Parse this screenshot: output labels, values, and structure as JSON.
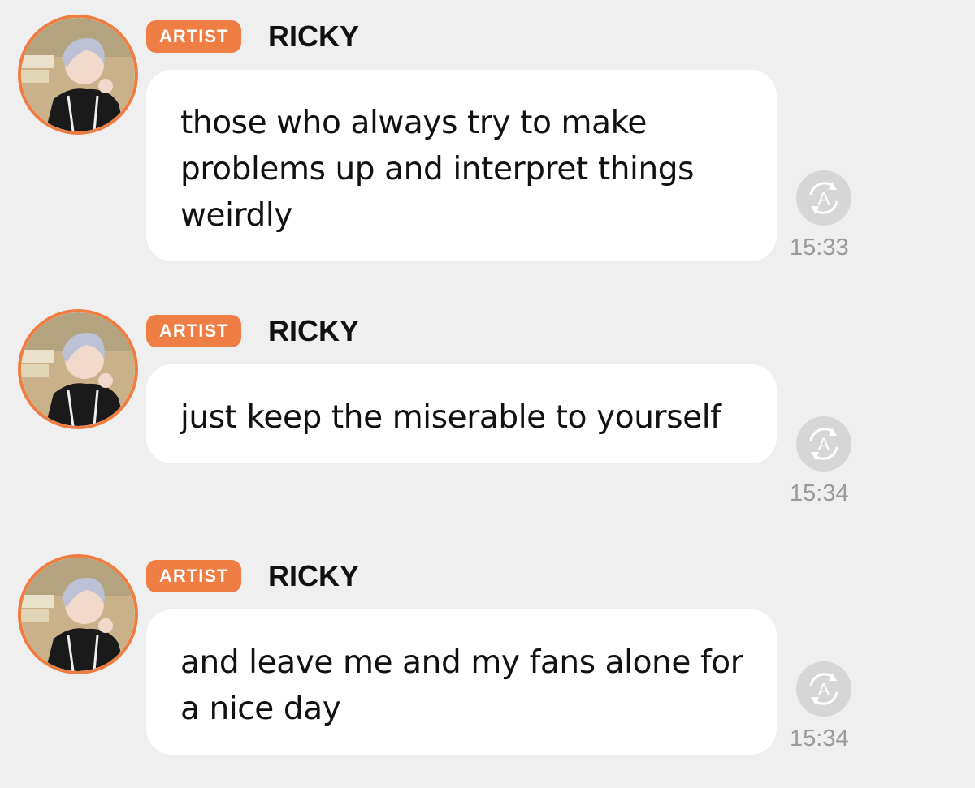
{
  "chat": {
    "messages": [
      {
        "badge": "ARTIST",
        "sender": "RICKY",
        "text": "those who always try to make problems up and interpret things weirdly",
        "time": "15:33",
        "translate_icon": "translate-icon"
      },
      {
        "badge": "ARTIST",
        "sender": "RICKY",
        "text": "just keep the miserable to yourself",
        "time": "15:34",
        "translate_icon": "translate-icon"
      },
      {
        "badge": "ARTIST",
        "sender": "RICKY",
        "text": "and leave me and my fans alone for a nice day",
        "time": "15:34",
        "translate_icon": "translate-icon"
      }
    ]
  },
  "colors": {
    "background": "#efefef",
    "accent": "#ef7e45",
    "bubble": "#ffffff",
    "timestamp": "#9a9a9a"
  }
}
